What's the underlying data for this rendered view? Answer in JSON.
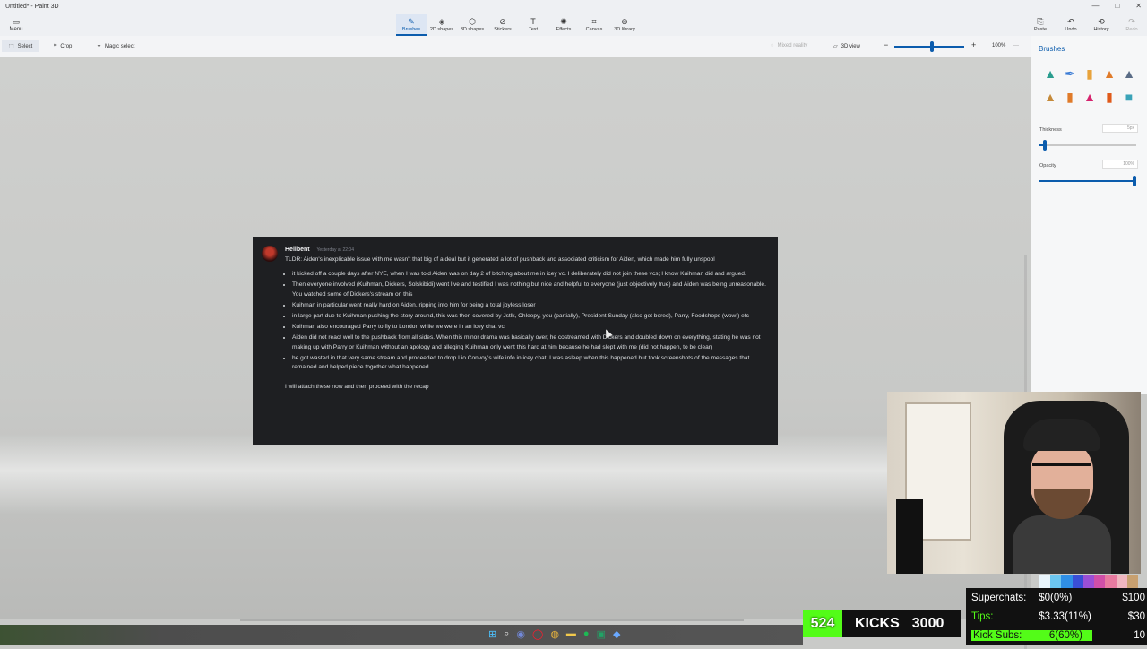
{
  "app": {
    "title": "Untitled* - Paint 3D",
    "window_controls": [
      "—",
      "□",
      "✕"
    ]
  },
  "ribbon": {
    "menu": {
      "label": "Menu",
      "icon": "menu-folder-icon"
    },
    "tabs": [
      {
        "label": "Brushes",
        "icon": "brush-icon",
        "active": true
      },
      {
        "label": "2D shapes",
        "icon": "shapes-2d-icon"
      },
      {
        "label": "3D shapes",
        "icon": "shapes-3d-icon"
      },
      {
        "label": "Stickers",
        "icon": "sticker-icon"
      },
      {
        "label": "Text",
        "icon": "text-icon"
      },
      {
        "label": "Effects",
        "icon": "effects-icon"
      },
      {
        "label": "Canvas",
        "icon": "canvas-icon"
      },
      {
        "label": "3D library",
        "icon": "library-icon"
      }
    ],
    "right": [
      {
        "label": "Paste",
        "icon": "paste-icon"
      },
      {
        "label": "Undo",
        "icon": "undo-icon"
      },
      {
        "label": "History",
        "icon": "history-icon"
      },
      {
        "label": "Redo",
        "icon": "redo-icon",
        "disabled": true
      }
    ]
  },
  "toolbar": {
    "select": "Select",
    "crop": "Crop",
    "magic_select": "Magic select",
    "mixed_reality": "Mixed reality",
    "view_3d": "3D view",
    "zoom_out": "−",
    "zoom_in": "+",
    "zoom": "100%",
    "more": "···"
  },
  "brushes_panel": {
    "title": "Brushes",
    "brushes": [
      {
        "icon": "marker-icon",
        "color": "#2a9d8f"
      },
      {
        "icon": "calligraphy-pen-icon",
        "color": "#3a7bd5"
      },
      {
        "icon": "oil-brush-icon",
        "color": "#e8a33c"
      },
      {
        "icon": "watercolor-icon",
        "color": "#e07b2a"
      },
      {
        "icon": "pixel-pen-icon",
        "color": "#5a6c86"
      },
      {
        "icon": "pencil-icon",
        "color": "#c58a3a"
      },
      {
        "icon": "eraser-icon",
        "color": "#e07b2a"
      },
      {
        "icon": "crayon-icon",
        "color": "#d6246e"
      },
      {
        "icon": "spray-can-icon",
        "color": "#e05a1a"
      },
      {
        "icon": "fill-icon",
        "color": "#3aa3b8"
      }
    ],
    "thickness_label": "Thickness",
    "thickness_value": "5px",
    "thickness_level": 0.04,
    "opacity_label": "Opacity",
    "opacity_value": "100%",
    "opacity_level": 1.0
  },
  "discord": {
    "author": "Hellbent",
    "timestamp": "Yesterday at 22:04",
    "intro": "TLDR: Aiden's inexplicable issue with me wasn't that big of a deal but it generated a lot of pushback and associated criticism for Aiden, which made him fully unspool",
    "bullets": [
      "it kicked off a couple days after NYE, when I was told Aiden was on day 2 of bitching about me in icey vc. I deliberately did not join these vcs; I know Kuihman did and argued.",
      "Then everyone involved (Kuihman, Dickers, Solskibidi) went live and testified I was nothing but nice and helpful to everyone (just objectively true) and Aiden was being unreasonable. You watched some of Dickers's stream on this",
      "Kuihman in particular went really hard on Aiden, ripping into him for being a total joyless loser",
      "in large part due to Kuihman pushing the story around, this was then covered by Jstlk, Chleepy, you (partially), President Sunday (also got bored), Parry, Foodshops (wow!) etc",
      "Kuihman also encouraged Parry to fly to London while we were in an icey chat vc",
      "Aiden did not react well to the pushback from all sides. When this minor drama was basically over, he costreamed with Dickers and doubled down on everything, stating he was not making up with Parry or Kuihman without an apology and alleging Kuihman only went this hard at him because he had slept with me (did not happen, to be clear)",
      "he got wasted in that very same stream and proceeded to drop Lio Convoy's wife info in icey chat. I was asleep when this happened but took screenshots of the messages that remained and helped piece together what happened"
    ],
    "footer": "I will attach these now and then proceed with the recap"
  },
  "colors": [
    "#e8f4fb",
    "#6cc6f0",
    "#2f8fe6",
    "#3a4fd6",
    "#9a4fd6",
    "#d04fa8",
    "#e87aa0",
    "#f0b6c0",
    "#c8a070"
  ],
  "overlay": {
    "kicks_count": "524",
    "kicks_label": "KICKS",
    "kicks_goal": "3000",
    "stats": [
      {
        "label": "Superchats:",
        "value": "$0(0%)",
        "goal": "$100"
      },
      {
        "label": "Tips:",
        "value": "$3.33(11%)",
        "goal": "$30"
      },
      {
        "label": "Kick Subs:",
        "value": "6(60%)",
        "goal": "10"
      }
    ]
  },
  "taskbar": {
    "icons": [
      "windows-start-icon",
      "search-icon",
      "discord-icon",
      "opera-icon",
      "chrome-icon",
      "folder-icon",
      "spotify-icon",
      "excel-icon",
      "app-icon"
    ]
  }
}
